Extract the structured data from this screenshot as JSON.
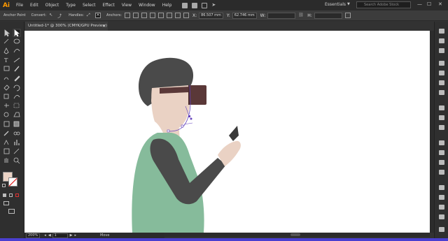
{
  "app": {
    "logo": "Ai",
    "accent": "#ff9a00"
  },
  "menu": [
    "File",
    "Edit",
    "Object",
    "Type",
    "Select",
    "Effect",
    "View",
    "Window",
    "Help"
  ],
  "workspace": {
    "label": "Essentials"
  },
  "search": {
    "placeholder": "Search Adobe Stock"
  },
  "control_bar": {
    "anchor_point": "Anchor Point",
    "convert": "Convert:",
    "handles": "Handles:",
    "anchors": "Anchors:",
    "x_label": "X:",
    "x_value": "86.507 mm",
    "y_label": "Y:",
    "y_value": "62.746 mm",
    "w_label": "W:",
    "h_label": "H:"
  },
  "document_tab": {
    "title": "Untitled-1* @ 300% (CMYK/GPU Preview)",
    "close": "×"
  },
  "status_bar": {
    "zoom": "200%",
    "artboard": "1",
    "tool": "Move"
  },
  "colors": {
    "hair": "#4a4a4a",
    "skin": "#ead2c4",
    "headset": "#5a3838",
    "shirt": "#86bb9b",
    "sleeve": "#4a4a4a",
    "path": "#6644bb",
    "fill_swatch": "#ead2c4"
  }
}
